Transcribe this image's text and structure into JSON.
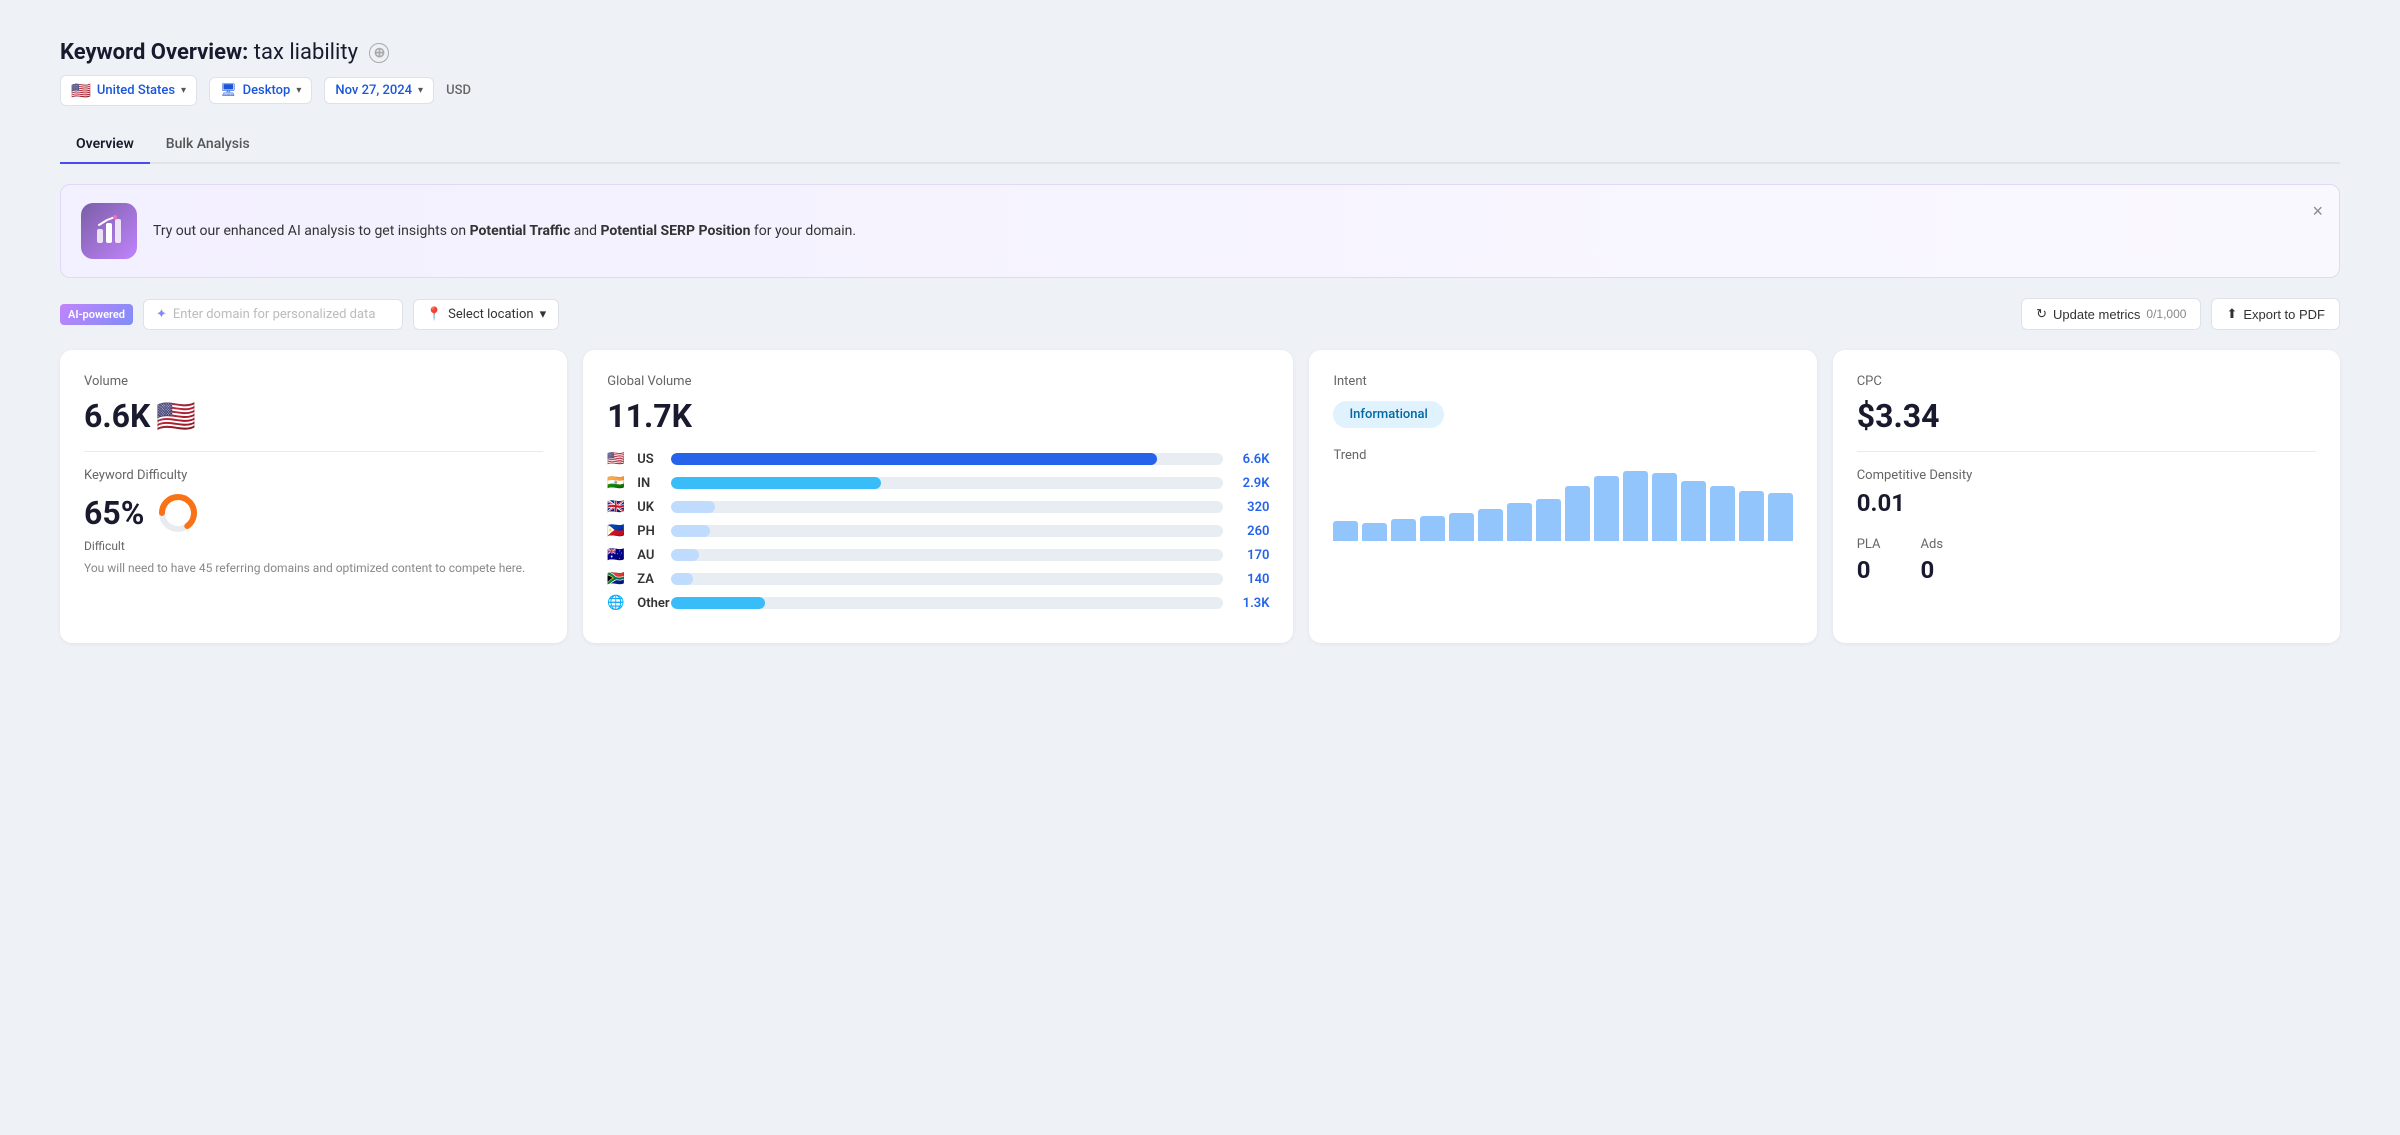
{
  "header": {
    "title_prefix": "Keyword Overview:",
    "keyword": "tax liability",
    "plus_icon": "⊕"
  },
  "filters": {
    "country_flag": "🇺🇸",
    "country": "United States",
    "device_icon": "🖥",
    "device": "Desktop",
    "date": "Nov 27, 2024",
    "currency": "USD"
  },
  "tabs": [
    {
      "label": "Overview",
      "active": true
    },
    {
      "label": "Bulk Analysis",
      "active": false
    }
  ],
  "ai_banner": {
    "text_before": "Try out our enhanced AI analysis to get insights on ",
    "bold1": "Potential Traffic",
    "text_mid": " and ",
    "bold2": "Potential SERP Position",
    "text_after": " for your domain.",
    "close": "×"
  },
  "toolbar": {
    "ai_badge": "AI-powered",
    "domain_placeholder": "Enter domain for personalized data",
    "location_placeholder": "Select location",
    "update_label": "Update metrics",
    "update_counter": "0/1,000",
    "export_label": "Export to PDF"
  },
  "volume_card": {
    "label": "Volume",
    "value": "6.6K",
    "flag": "🇺🇸"
  },
  "kd_card": {
    "label": "Keyword Difficulty",
    "value": "65%",
    "difficulty_label": "Difficult",
    "donut_percent": 65,
    "description": "You will need to have 45 referring domains and optimized content to compete here."
  },
  "global_volume_card": {
    "label": "Global Volume",
    "value": "11.7K",
    "countries": [
      {
        "flag": "🇺🇸",
        "code": "US",
        "bar_pct": 88,
        "value": "6.6K",
        "bar_class": "bar-us"
      },
      {
        "flag": "🇮🇳",
        "code": "IN",
        "bar_pct": 38,
        "value": "2.9K",
        "bar_class": "bar-in"
      },
      {
        "flag": "🇬🇧",
        "code": "UK",
        "bar_pct": 8,
        "value": "320",
        "bar_class": "bar-uk"
      },
      {
        "flag": "🇵🇭",
        "code": "PH",
        "bar_pct": 7,
        "value": "260",
        "bar_class": "bar-ph"
      },
      {
        "flag": "🇦🇺",
        "code": "AU",
        "bar_pct": 5,
        "value": "170",
        "bar_class": "bar-au"
      },
      {
        "flag": "🇿🇦",
        "code": "ZA",
        "bar_pct": 4,
        "value": "140",
        "bar_class": "bar-za"
      },
      {
        "flag": "🌐",
        "code": "Other",
        "bar_pct": 17,
        "value": "1.3K",
        "bar_class": "bar-other"
      }
    ]
  },
  "intent_card": {
    "label": "Intent",
    "badge": "Informational",
    "trend_label": "Trend",
    "trend_bars": [
      20,
      18,
      22,
      25,
      28,
      32,
      38,
      42,
      55,
      65,
      70,
      68,
      60,
      55,
      50,
      48
    ]
  },
  "cpc_card": {
    "label": "CPC",
    "value": "$3.34",
    "comp_density_label": "Competitive Density",
    "comp_density_value": "0.01",
    "pla_label": "PLA",
    "pla_value": "0",
    "ads_label": "Ads",
    "ads_value": "0"
  }
}
